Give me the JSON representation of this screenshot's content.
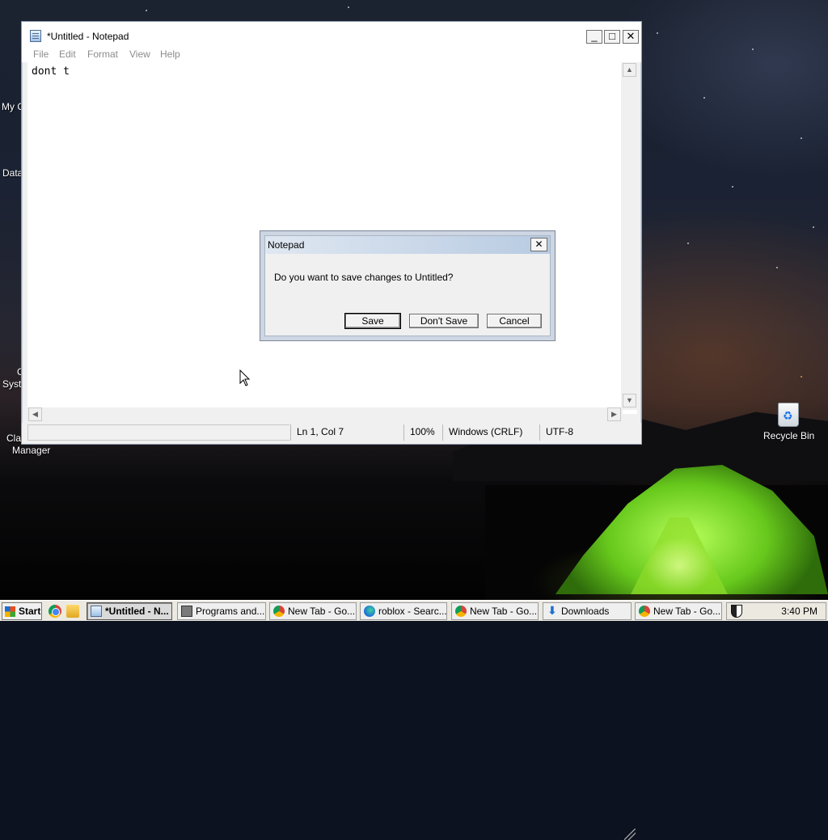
{
  "desktop": {
    "icons": [
      {
        "label": "Recycle Bin"
      }
    ],
    "partial_labels": [
      "My C",
      "Data",
      "C",
      "Syste",
      "Cla",
      "Manager"
    ]
  },
  "notepad": {
    "title": "*Untitled - Notepad",
    "menu": [
      "File",
      "Edit",
      "Format",
      "View",
      "Help"
    ],
    "content": "dont t",
    "status": {
      "position": "Ln 1, Col 7",
      "zoom": "100%",
      "line_ending": "Windows (CRLF)",
      "encoding": "UTF-8"
    }
  },
  "dialog": {
    "title": "Notepad",
    "message": "Do you want to save changes to Untitled?",
    "buttons": {
      "save": "Save",
      "dont_save": "Don't Save",
      "cancel": "Cancel"
    }
  },
  "taskbar": {
    "start_label": "Start",
    "tasks": [
      {
        "label": "*Untitled - N...",
        "icon": "notepad-icon",
        "active": true
      },
      {
        "label": "Programs and...",
        "icon": "programs-icon",
        "active": false
      },
      {
        "label": "New Tab - Go...",
        "icon": "chrome-icon",
        "active": false
      },
      {
        "label": "roblox - Searc...",
        "icon": "edge-icon",
        "active": false
      },
      {
        "label": "New Tab - Go...",
        "icon": "chrome-icon",
        "active": false
      },
      {
        "label": "Downloads",
        "icon": "download-icon",
        "active": false
      },
      {
        "label": "New Tab - Go...",
        "icon": "chrome-icon",
        "active": false
      }
    ],
    "clock": "3:40 PM"
  },
  "colors": {
    "tent_green": "#8fdc2a",
    "dialog_title_gradient_end": "#b8cbe2",
    "taskbar_bg": "#ece9e1"
  }
}
